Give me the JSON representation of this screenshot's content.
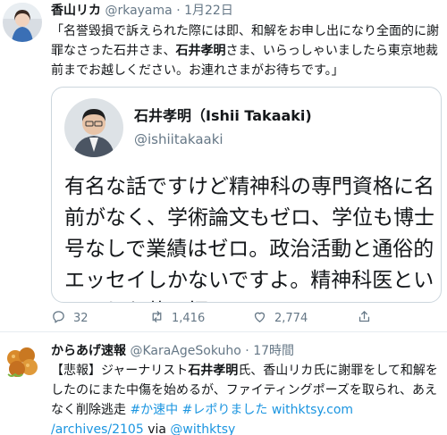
{
  "tweet1": {
    "name": "香山リカ",
    "handle": "@rkayama",
    "separator": "·",
    "time": "1月22日",
    "text_parts": [
      "「名誉毀損で訴えられた際には即、和解をお申し出になり全面的に謝罪なさった石井さま、",
      "石井孝明",
      "さま、いらっしゃいましたら東京地裁前までお越しください。お連れさまがお待ちです。」"
    ],
    "quote": {
      "name": "石井孝明（Ishii Takaaki)",
      "handle": "@ishiitakaaki",
      "text": "有名な話ですけど精神科の専門資格に名前がなく、学術論文もゼロ、学位も博士号なしで業績はゼロ。政治活動と通俗的エッセイしかないですよ。精神科医というよりお薬医師で"
    },
    "actions": {
      "reply_count": "32",
      "retweet_count": "1,416",
      "like_count": "2,774"
    }
  },
  "tweet2": {
    "name": "からあげ速報",
    "handle": "@KaraAgeSokuho",
    "separator": "·",
    "time": "17時間",
    "text_parts": {
      "a": "【悲報】ジャーナリスト",
      "b": "石井孝明",
      "c": "氏、香山リカ氏に謝罪をして和解をしたのにまた中傷を始めるが、ファイティングポーズを取られ、あえなく削除逃走 ",
      "tag1": "#か速中",
      "space": " ",
      "tag2": "#レポりました",
      "space2": " ",
      "link": "withktsy.com /archives/2105",
      "via": " via ",
      "mention": "@withktsy"
    }
  },
  "colors": {
    "link": "#1b95e0",
    "secondary_text": "#657786",
    "border": "#ccd6dd"
  },
  "icons": [
    "reply-icon",
    "retweet-icon",
    "like-icon",
    "share-icon"
  ]
}
